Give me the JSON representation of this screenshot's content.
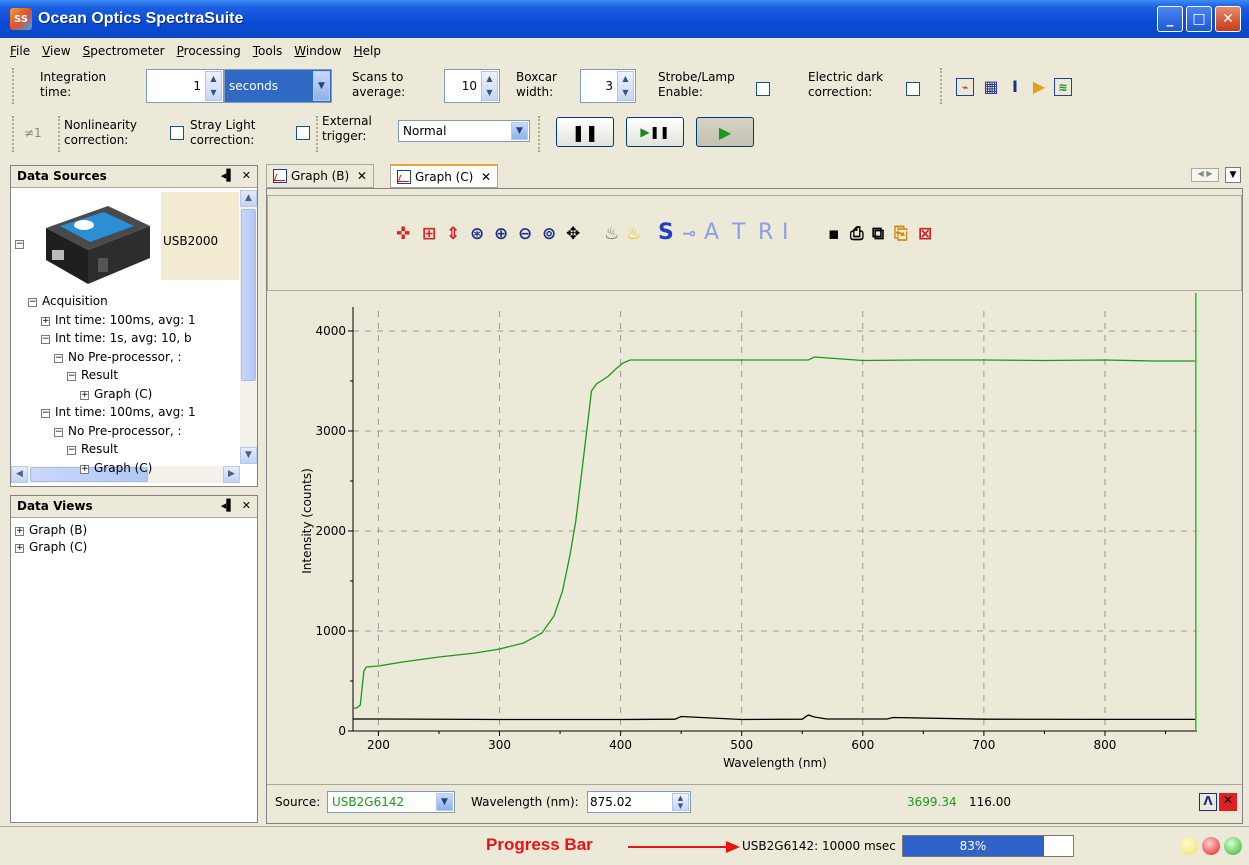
{
  "window": {
    "title": "Ocean Optics SpectraSuite",
    "app_icon": "SS"
  },
  "menu": [
    {
      "u": "F",
      "rest": "ile"
    },
    {
      "u": "V",
      "rest": "iew"
    },
    {
      "u": "S",
      "rest": "pectrometer"
    },
    {
      "u": "P",
      "rest": "rocessing"
    },
    {
      "u": "T",
      "rest": "ools"
    },
    {
      "u": "W",
      "rest": "indow"
    },
    {
      "u": "H",
      "rest": "elp"
    }
  ],
  "toolbar1": {
    "integration_label_1": "Integration",
    "integration_label_2": "time:",
    "integration_value": "1",
    "units": "seconds",
    "scans_label_1": "Scans to",
    "scans_label_2": "average:",
    "scans_value": "10",
    "boxcar_label_1": "Boxcar",
    "boxcar_label_2": "width:",
    "boxcar_value": "3",
    "strobe_label_1": "Strobe/Lamp",
    "strobe_label_2": "Enable:",
    "dark_label_1": "Electric dark",
    "dark_label_2": "correction:"
  },
  "toolbar2": {
    "nl_icon": "≠1",
    "nonlin_label_1": "Nonlinearity",
    "nonlin_label_2": "correction:",
    "stray_label_1": "Stray Light",
    "stray_label_2": "correction:",
    "ext_label_1": "External",
    "ext_label_2": "trigger:",
    "trigger_mode": "Normal"
  },
  "data_sources": {
    "title": "Data Sources",
    "device": "USB2000",
    "tree": [
      {
        "text": "Acquisition",
        "indent": 1,
        "pm": "−"
      },
      {
        "text": "Int time: 100ms, avg: 1",
        "indent": 2,
        "pm": "+"
      },
      {
        "text": "Int time: 1s, avg: 10, b",
        "indent": 2,
        "pm": "−"
      },
      {
        "text": "No Pre-processor, :",
        "indent": 3,
        "pm": "−"
      },
      {
        "text": "Result",
        "indent": 4,
        "pm": "−"
      },
      {
        "text": "Graph (C)",
        "indent": 5,
        "pm": "+"
      },
      {
        "text": "Int time: 100ms, avg: 1",
        "indent": 2,
        "pm": "−"
      },
      {
        "text": "No Pre-processor, :",
        "indent": 3,
        "pm": "−"
      },
      {
        "text": "Result",
        "indent": 4,
        "pm": "−"
      },
      {
        "text": "Graph (C)",
        "indent": 5,
        "pm": "+"
      }
    ]
  },
  "data_views": {
    "title": "Data Views",
    "items": [
      "Graph (B)",
      "Graph (C)"
    ]
  },
  "tabs": [
    "Graph (B)",
    "Graph (C)"
  ],
  "graph_toolbar": {
    "letters": [
      "S",
      "A",
      "T",
      "R",
      "I"
    ]
  },
  "bottom": {
    "source_label": "Source:",
    "source_value": "USB2G6142",
    "wavelength_label": "Wavelength (nm):",
    "wavelength_value": "875.02",
    "intensity_green": "3699.34",
    "intensity_black": "116.00"
  },
  "status": {
    "progress_label": "Progress Bar",
    "progress_text": "USB2G6142: 10000 msec",
    "progress_value": 0.83,
    "progress_pct": "83%"
  },
  "colors": {
    "green_series": "#1a9a1a",
    "black_series": "#000000",
    "accent_blue": "#316ac5"
  },
  "chart_data": {
    "type": "line",
    "xlabel": "Wavelength (nm)",
    "ylabel": "Intensity (counts)",
    "xlim": [
      179,
      876
    ],
    "ylim": [
      0,
      4200
    ],
    "xticks": [
      200,
      300,
      400,
      500,
      600,
      700,
      800
    ],
    "yticks": [
      0,
      1000,
      2000,
      3000,
      4000
    ],
    "grid": true,
    "series": [
      {
        "color": "#1a9a1a",
        "x": [
          179,
          182,
          185,
          188,
          190,
          200,
          220,
          250,
          280,
          300,
          320,
          335,
          345,
          352,
          358,
          363,
          368,
          372,
          376,
          380,
          384,
          390,
          396,
          402,
          408,
          414,
          420,
          450,
          500,
          555,
          560,
          600,
          650,
          700,
          750,
          800,
          840,
          875
        ],
        "y": [
          230,
          230,
          260,
          600,
          640,
          650,
          690,
          740,
          780,
          820,
          880,
          980,
          1150,
          1400,
          1750,
          2100,
          2600,
          3000,
          3400,
          3470,
          3500,
          3550,
          3620,
          3680,
          3710,
          3710,
          3710,
          3710,
          3710,
          3710,
          3740,
          3705,
          3710,
          3710,
          3705,
          3710,
          3700,
          3700
        ]
      },
      {
        "color": "#000000",
        "x": [
          179,
          200,
          300,
          400,
          445,
          450,
          500,
          550,
          555,
          560,
          570,
          620,
          625,
          700,
          800,
          875
        ],
        "y": [
          120,
          120,
          115,
          115,
          118,
          145,
          115,
          118,
          160,
          140,
          120,
          120,
          135,
          118,
          116,
          116
        ]
      }
    ]
  }
}
